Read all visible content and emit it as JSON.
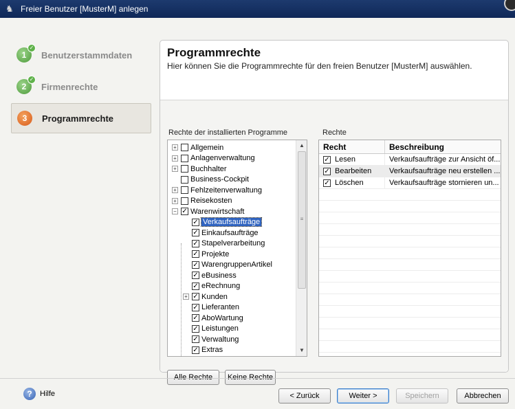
{
  "window": {
    "title": "Freier Benutzer [MusterM] anlegen"
  },
  "steps": [
    {
      "num": "1",
      "label": "Benutzerstammdaten",
      "done": true
    },
    {
      "num": "2",
      "label": "Firmenrechte",
      "done": true
    },
    {
      "num": "3",
      "label": "Programmrechte",
      "done": false
    }
  ],
  "header": {
    "title": "Programmrechte",
    "subtitle": "Hier können Sie die Programmrechte für den freien Benutzer [MusterM] auswählen."
  },
  "tree": {
    "group_label": "Rechte der installierten Programme",
    "items": [
      {
        "label": "Allgemein",
        "checked": false,
        "expander": "+"
      },
      {
        "label": "Anlagenverwaltung",
        "checked": false,
        "expander": "+"
      },
      {
        "label": "Buchhalter",
        "checked": false,
        "expander": "+"
      },
      {
        "label": "Business-Cockpit",
        "checked": false,
        "expander": ""
      },
      {
        "label": "Fehlzeitenverwaltung",
        "checked": false,
        "expander": "+"
      },
      {
        "label": "Reisekosten",
        "checked": false,
        "expander": "+"
      },
      {
        "label": "Warenwirtschaft",
        "checked": true,
        "expander": "-"
      },
      {
        "label": "Verkaufsaufträge",
        "checked": true,
        "expander": "",
        "child": true,
        "selected": true
      },
      {
        "label": "Einkaufsaufträge",
        "checked": true,
        "expander": "",
        "child": true
      },
      {
        "label": "Stapelverarbeitung",
        "checked": true,
        "expander": "",
        "child": true
      },
      {
        "label": "Projekte",
        "checked": true,
        "expander": "",
        "child": true
      },
      {
        "label": "WarengruppenArtikel",
        "checked": true,
        "expander": "",
        "child": true
      },
      {
        "label": "eBusiness",
        "checked": true,
        "expander": "",
        "child": true
      },
      {
        "label": "eRechnung",
        "checked": true,
        "expander": "",
        "child": true
      },
      {
        "label": "Kunden",
        "checked": true,
        "expander": "+",
        "child": true
      },
      {
        "label": "Lieferanten",
        "checked": true,
        "expander": "",
        "child": true
      },
      {
        "label": "AboWartung",
        "checked": true,
        "expander": "",
        "child": true
      },
      {
        "label": "Leistungen",
        "checked": true,
        "expander": "",
        "child": true
      },
      {
        "label": "Verwaltung",
        "checked": true,
        "expander": "",
        "child": true
      },
      {
        "label": "Extras",
        "checked": true,
        "expander": "",
        "child": true
      }
    ]
  },
  "rights": {
    "group_label": "Rechte",
    "col_recht": "Recht",
    "col_beschreibung": "Beschreibung",
    "rows": [
      {
        "recht": "Lesen",
        "beschreibung": "Verkaufsaufträge zur Ansicht öf...",
        "checked": true
      },
      {
        "recht": "Bearbeiten",
        "beschreibung": "Verkaufsaufträge neu erstellen ...",
        "checked": true,
        "selected": true
      },
      {
        "recht": "Löschen",
        "beschreibung": "Verkaufsaufträge stornieren un...",
        "checked": true
      }
    ]
  },
  "buttons": {
    "alle_rechte": "Alle Rechte",
    "keine_rechte": "Keine Rechte",
    "zurueck": "< Zurück",
    "weiter": "Weiter >",
    "speichern": "Speichern",
    "abbrechen": "Abbrechen"
  },
  "help": {
    "label": "Hilfe"
  }
}
